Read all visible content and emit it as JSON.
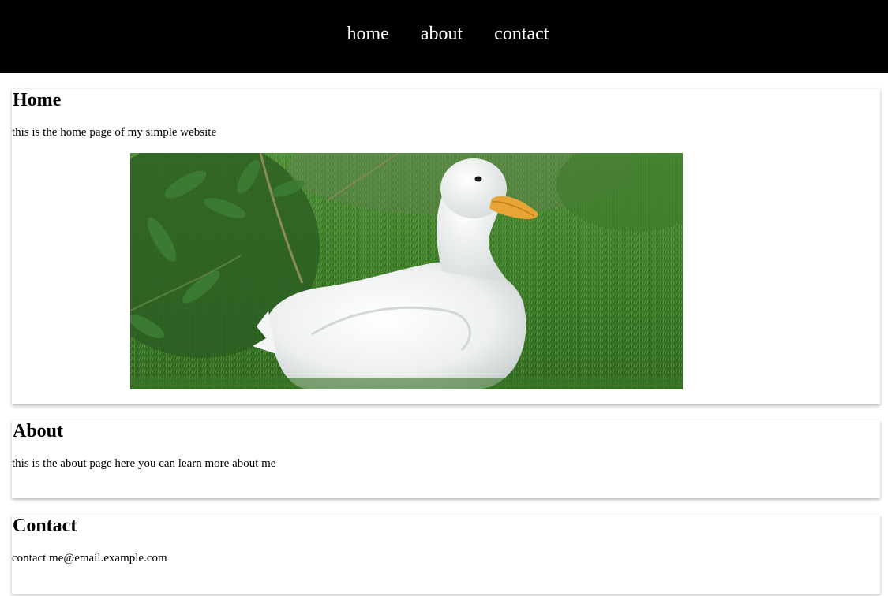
{
  "nav": {
    "items": [
      {
        "label": "home"
      },
      {
        "label": "about"
      },
      {
        "label": "contact"
      }
    ]
  },
  "sections": {
    "home": {
      "title": "Home",
      "text": "this is the home page of my simple website",
      "image_alt": "white duck sitting on grass"
    },
    "about": {
      "title": "About",
      "text": "this is the about page here you can learn more about me"
    },
    "contact": {
      "title": "Contact",
      "text": "contact me@email.example.com"
    }
  },
  "colors": {
    "topbar_bg": "#000000",
    "nav_text": "#ffffff",
    "page_bg": "#ffffff"
  }
}
